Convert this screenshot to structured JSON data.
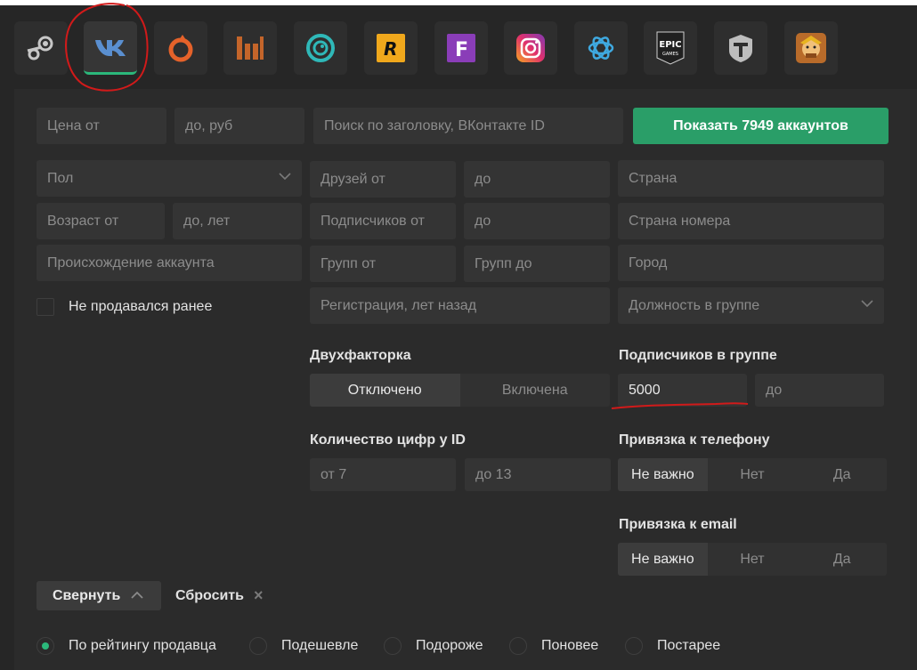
{
  "platforms": [
    {
      "name": "Steam",
      "icon": "steam-icon"
    },
    {
      "name": "ВКонтакте",
      "icon": "vk-icon",
      "active": true
    },
    {
      "name": "Origin",
      "icon": "origin-icon"
    },
    {
      "name": "Warface",
      "icon": "warface-icon"
    },
    {
      "name": "Uplay",
      "icon": "uplay-icon"
    },
    {
      "name": "Rockstar",
      "icon": "rockstar-icon",
      "glyph": "R"
    },
    {
      "name": "Fortnite",
      "icon": "fortnite-icon",
      "glyph": "F"
    },
    {
      "name": "Instagram",
      "icon": "instagram-icon"
    },
    {
      "name": "Battle.net",
      "icon": "battlenet-icon"
    },
    {
      "name": "Epic Games",
      "icon": "epic-games-icon",
      "glyph": "EPIC",
      "sub": "GAMES"
    },
    {
      "name": "World of Tanks",
      "icon": "world-of-tanks-icon"
    },
    {
      "name": "Clash of Clans",
      "icon": "clash-of-clans-icon"
    }
  ],
  "filters": {
    "price_from": "Цена от",
    "price_to": "до, руб",
    "search": "Поиск по заголовку, ВКонтакте ID",
    "show_button": "Показать 7949 аккаунтов",
    "gender": "Пол",
    "friends_from": "Друзей от",
    "friends_to": "до",
    "country": "Страна",
    "age_from": "Возраст от",
    "age_to": "до, лет",
    "followers_from": "Подписчиков от",
    "followers_to": "до",
    "phone_country": "Страна номера",
    "origin": "Происхождение аккаунта",
    "groups_from": "Групп от",
    "groups_to": "Групп до",
    "city": "Город",
    "not_sold": "Не продавался ранее",
    "registration": "Регистрация, лет назад",
    "group_role": "Должность в группе"
  },
  "two_factor": {
    "label": "Двухфакторка",
    "options": [
      "Отключено",
      "Включена"
    ],
    "selected": 0
  },
  "group_subscribers": {
    "label": "Подписчиков в группе",
    "from_value": "5000",
    "to_placeholder": "до"
  },
  "id_digits": {
    "label": "Количество цифр у ID",
    "from": "от 7",
    "to": "до 13"
  },
  "phone_link": {
    "label": "Привязка к телефону",
    "options": [
      "Не важно",
      "Нет",
      "Да"
    ],
    "selected": 0
  },
  "email_link": {
    "label": "Привязка к email",
    "options": [
      "Не важно",
      "Нет",
      "Да"
    ],
    "selected": 0
  },
  "actions": {
    "collapse": "Свернуть",
    "reset": "Сбросить",
    "reset_icon": "×"
  },
  "sort": {
    "options": [
      "По рейтингу продавца",
      "Подешевле",
      "Подороже",
      "Поновее",
      "Постарее"
    ],
    "selected": 0
  },
  "colors": {
    "accent": "#2a9e68",
    "annotation": "#d11a1a",
    "background": "#262626",
    "panel": "#2b2b2b"
  }
}
